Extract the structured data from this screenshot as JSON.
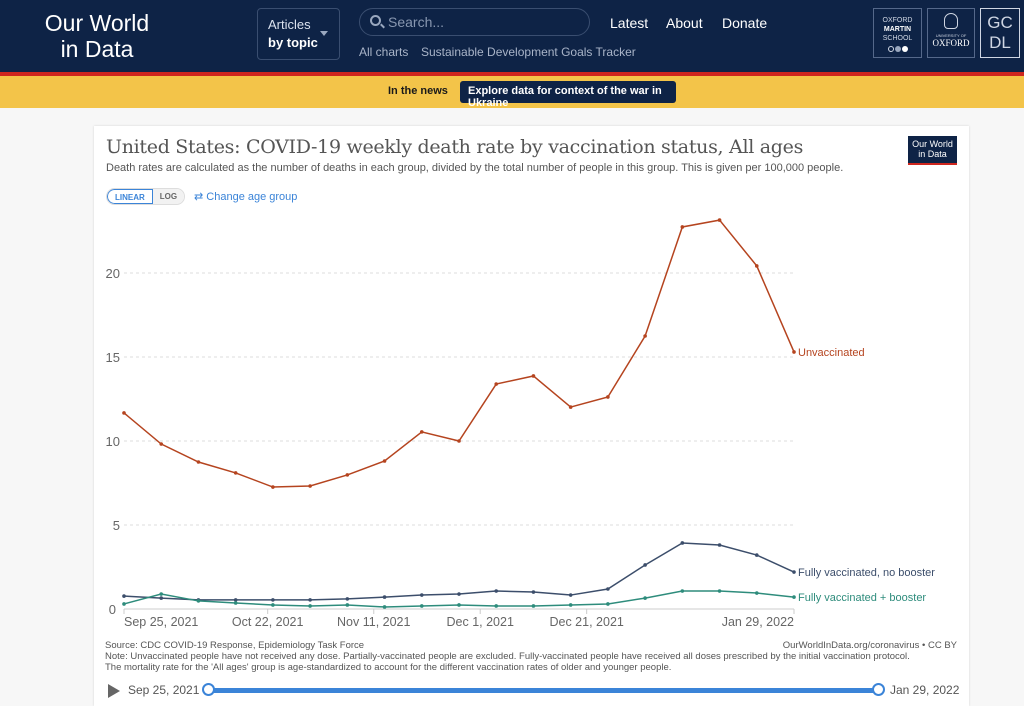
{
  "site": {
    "logo_line1": "Our World",
    "logo_line2": "in Data",
    "articles_line1": "Articles",
    "articles_line2": "by topic",
    "search_placeholder": "Search...",
    "subnav": [
      "All charts",
      "Sustainable Development Goals Tracker"
    ],
    "nav": [
      "Latest",
      "About",
      "Donate"
    ],
    "partners": {
      "oms": [
        "OXFORD",
        "MARTIN",
        "SCHOOL"
      ],
      "oxford_small": "UNIVERSITY OF",
      "oxford": "OXFORD",
      "gcdl": [
        "GC",
        "DL"
      ]
    }
  },
  "banner": {
    "label": "In the news",
    "button": "Explore data for context of the war in Ukraine"
  },
  "card": {
    "title": "United States: COVID-19 weekly death rate by vaccination status, All ages",
    "subtitle": "Death rates are calculated as the number of deaths in each group, divided by the total number of people in this group. This is given per 100,000 people.",
    "owid_mini": [
      "Our World",
      "in Data"
    ],
    "scale_linear": "LINEAR",
    "scale_log": "LOG",
    "change_age": "Change age group",
    "source": "Source: CDC COVID-19 Response, Epidemiology Task Force",
    "note": "Note: Unvaccinated people have not received any dose. Partially-vaccinated people are excluded. Fully-vaccinated people have received all doses prescribed by the initial vaccination protocol. The mortality rate for the 'All ages' group is age-standardized to account for the different vaccination rates of older and younger people.",
    "credit": "OurWorldInData.org/coronavirus • CC BY",
    "timeline": {
      "start": "Sep 25, 2021",
      "end": "Jan 29, 2022",
      "start_fraction": 0,
      "end_fraction": 1
    }
  },
  "chart_data": {
    "type": "line",
    "title": "United States: COVID-19 weekly death rate by vaccination status, All ages",
    "xlabel": "",
    "ylabel": "",
    "ylim": [
      0,
      24
    ],
    "yticks": [
      0,
      5,
      10,
      15,
      20
    ],
    "grid": true,
    "x": [
      "2021-09-25",
      "2021-10-02",
      "2021-10-09",
      "2021-10-16",
      "2021-10-23",
      "2021-10-30",
      "2021-11-06",
      "2021-11-13",
      "2021-11-20",
      "2021-11-27",
      "2021-12-04",
      "2021-12-11",
      "2021-12-18",
      "2021-12-25",
      "2022-01-01",
      "2022-01-08",
      "2022-01-15",
      "2022-01-22",
      "2022-01-29"
    ],
    "xtick_labels": [
      {
        "label": "Sep 25, 2021",
        "index": 0
      },
      {
        "label": "Oct 22, 2021",
        "index": 3.86
      },
      {
        "label": "Nov 11, 2021",
        "index": 6.71
      },
      {
        "label": "Dec 1, 2021",
        "index": 9.57
      },
      {
        "label": "Dec 21, 2021",
        "index": 12.43
      },
      {
        "label": "Jan 29, 2022",
        "index": 18
      }
    ],
    "series": [
      {
        "name": "Unvaccinated",
        "color": "#b5441f",
        "values": [
          11.67,
          9.82,
          8.75,
          8.1,
          7.26,
          7.32,
          7.98,
          8.81,
          10.54,
          10.0,
          13.39,
          13.87,
          12.02,
          12.62,
          16.25,
          22.74,
          23.15,
          20.42,
          15.3
        ]
      },
      {
        "name": "Fully vaccinated, no booster",
        "color": "#3c4e6b",
        "values": [
          0.77,
          0.65,
          0.54,
          0.54,
          0.54,
          0.54,
          0.6,
          0.71,
          0.83,
          0.89,
          1.07,
          1.01,
          0.83,
          1.19,
          2.62,
          3.93,
          3.81,
          3.21,
          2.2
        ]
      },
      {
        "name": "Fully vaccinated + booster",
        "color": "#2e8c7c",
        "values": [
          0.3,
          0.89,
          0.48,
          0.36,
          0.24,
          0.18,
          0.24,
          0.12,
          0.18,
          0.24,
          0.18,
          0.18,
          0.24,
          0.3,
          0.65,
          1.07,
          1.07,
          0.95,
          0.71
        ]
      }
    ],
    "legend": "inline-right"
  }
}
